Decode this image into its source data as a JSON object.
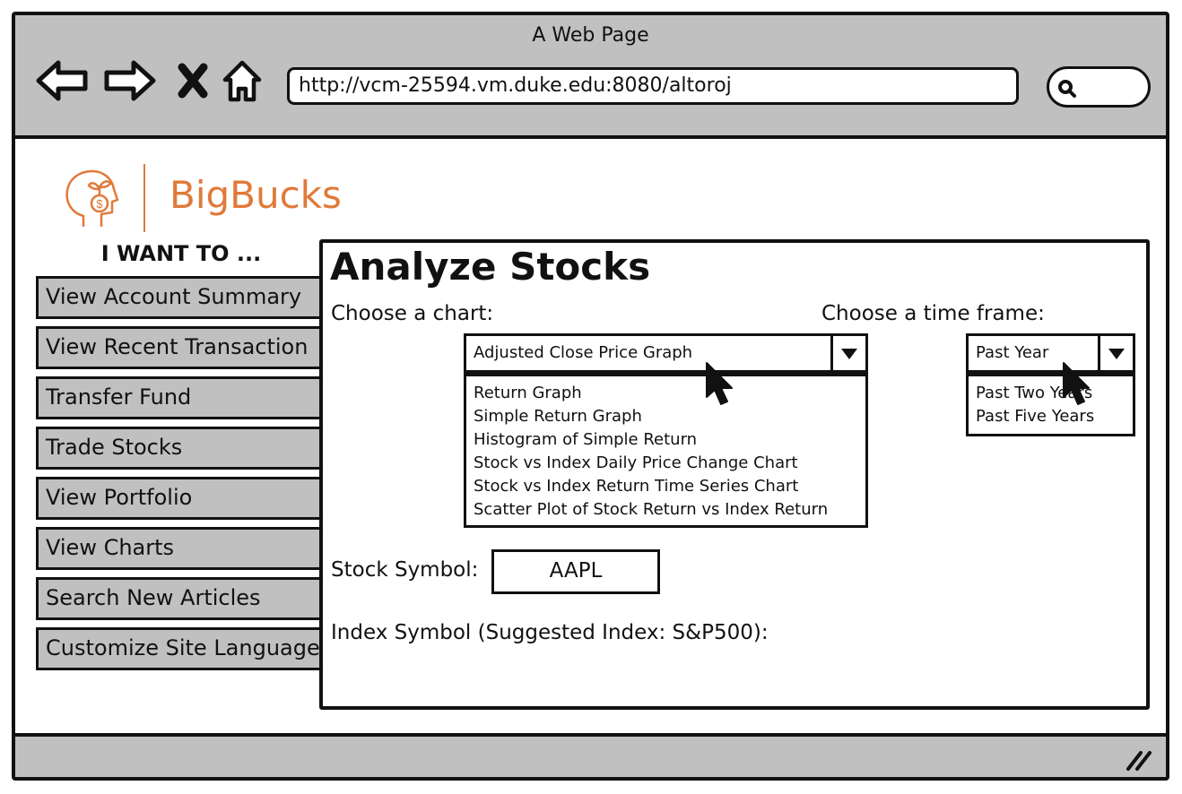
{
  "window": {
    "title": "A Web Page"
  },
  "browser": {
    "url": "http://vcm-25594.vm.duke.edu:8080/altoroj"
  },
  "logo": {
    "name": "BigBucks"
  },
  "sidebar": {
    "heading": "I WANT TO ...",
    "items": [
      {
        "label": "View Account Summary"
      },
      {
        "label": "View Recent Transaction"
      },
      {
        "label": "Transfer Fund"
      },
      {
        "label": "Trade Stocks"
      },
      {
        "label": "View Portfolio"
      },
      {
        "label": "View Charts"
      },
      {
        "label": "Search New Articles"
      },
      {
        "label": "Customize Site Language"
      }
    ]
  },
  "main": {
    "title": "Analyze Stocks",
    "chart_label": "Choose a chart:",
    "chart_select": {
      "value": "Adjusted Close Price Graph",
      "options": [
        "Return Graph",
        "Simple Return Graph",
        "Histogram of Simple Return",
        "Stock vs Index Daily Price Change Chart",
        "Stock vs Index Return Time Series Chart",
        "Scatter Plot of Stock Return vs Index Return"
      ]
    },
    "timeframe_label": "Choose a time frame:",
    "timeframe_select": {
      "value": "Past Year",
      "options": [
        "Past Two Years",
        "Past Five Years"
      ]
    },
    "stock_label": "Stock Symbol:",
    "stock_value": "AAPL",
    "index_label": "Index Symbol (Suggested Index: S&P500):"
  },
  "colors": {
    "brand": "#e07a3a",
    "chrome": "#c0c0c0",
    "ink": "#111111"
  }
}
